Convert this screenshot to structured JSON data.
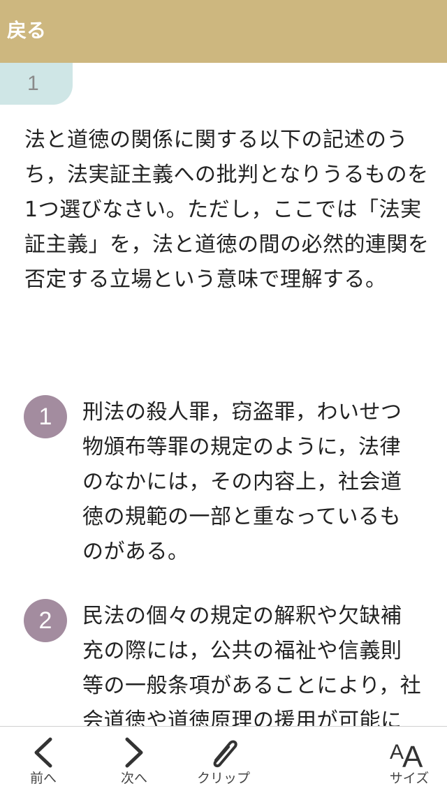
{
  "header": {
    "back_label": "戻る"
  },
  "question": {
    "number": "1",
    "text": "法と道徳の関係に関する以下の記述のうち，法実証主義への批判となりうるものを1つ選びなさい。ただし，ここでは「法実証主義」を，法と道徳の間の必然的連関を否定する立場という意味で理解する。"
  },
  "choices": [
    {
      "number": "1",
      "text": "刑法の殺人罪，窃盗罪，わいせつ物頒布等罪の規定のように，法律のなかには，その内容上，社会道徳の規範の一部と重なっているものがある。"
    },
    {
      "number": "2",
      "text": "民法の個々の規定の解釈や欠缺補充の際には，公共の福祉や信義則等の一般条項があることにより，社会道徳や道徳原理の援用が可能になっている。"
    }
  ],
  "toolbar": {
    "prev_label": "前へ",
    "next_label": "次へ",
    "clip_label": "クリップ",
    "size_label": "サイズ"
  },
  "icons": {
    "prev": "chevron-left-icon",
    "next": "chevron-right-icon",
    "clip": "paperclip-icon",
    "size": "font-size-icon"
  },
  "colors": {
    "header_bg": "#cdb77f",
    "qnum_tab_bg": "#cfe6e6",
    "choice_badge_bg": "#a38c9f"
  }
}
